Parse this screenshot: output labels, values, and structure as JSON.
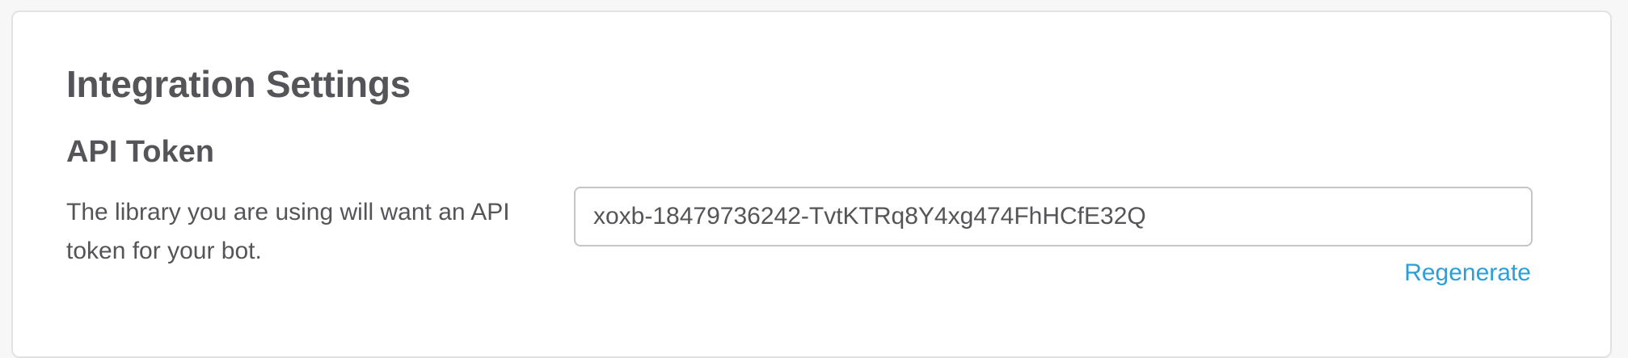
{
  "integration_settings": {
    "title": "Integration Settings",
    "api_token": {
      "label": "API Token",
      "description": "The library you are using will want an API token for your bot.",
      "value": "xoxb-18479736242-TvtKTRq8Y4xg474FhHCfE32Q",
      "regenerate_label": "Regenerate"
    }
  },
  "colors": {
    "text": "#555459",
    "link": "#2a9fd8",
    "border": "#c5c5c5",
    "card_border": "#e2e2e2"
  }
}
